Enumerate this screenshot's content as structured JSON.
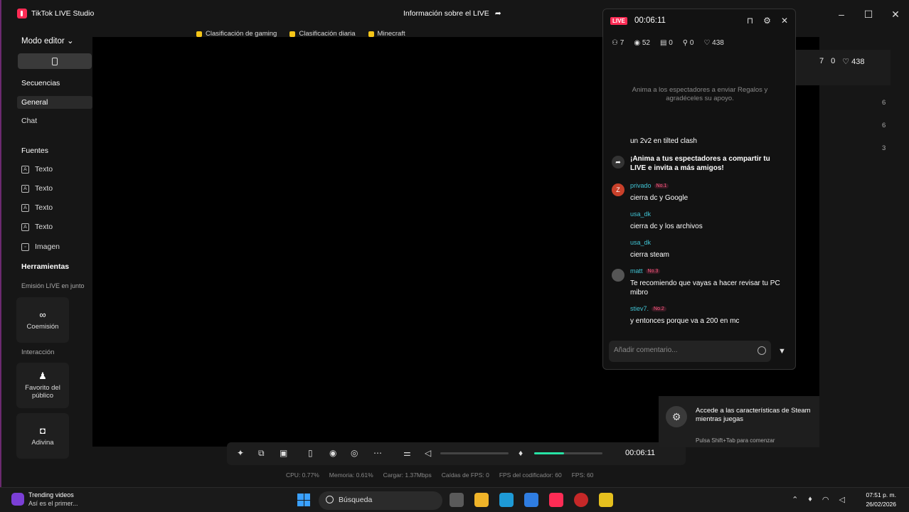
{
  "titlebar": {
    "app_name": "TikTok LIVE Studio",
    "live_info": "Información sobre el LIVE"
  },
  "sidebar": {
    "mode": "Modo editor",
    "scenes_title": "Secuencias",
    "scenes": [
      "General",
      "Chat"
    ],
    "sources_title": "Fuentes",
    "sources": [
      "Texto",
      "Texto",
      "Texto",
      "Texto",
      "Imagen"
    ],
    "tools_title": "Herramientas",
    "tools_sub": "Emisión LIVE en junto",
    "tools": {
      "coemision": "Coemisión",
      "interaccion_title": "Interacción",
      "favorito": "Favorito del público",
      "adivina": "Adivina"
    }
  },
  "tags": [
    "Clasificación de gaming",
    "Clasificación diaria",
    "Minecraft"
  ],
  "controls": {
    "timer": "00:06:11",
    "mic_level": 0.44
  },
  "stats_bar": [
    "CPU: 0.77%",
    "Memoria: 0.61%",
    "Cargar: 1.37Mbps",
    "Caídas de FPS: 0",
    "FPS del codificador: 60",
    "FPS: 60"
  ],
  "right_peek": {
    "users": "7",
    "gifts": "0",
    "likes": "438",
    "nums": [
      "6",
      "6",
      "3"
    ]
  },
  "chat": {
    "live_badge": "LIVE",
    "time": "00:06:11",
    "metrics": {
      "viewers": "7",
      "views": "52",
      "gifts": "0",
      "followers": "0",
      "likes": "438"
    },
    "promo": "Anima a los espectadores a enviar Regalos y agradéceles su apoyo.",
    "messages": [
      {
        "text": "un 2v2 en tilted clash"
      },
      {
        "text": "¡Anima a tus espectadores a compartir tu LIVE e invita a más amigos!"
      },
      {
        "user": "privado",
        "badge": "No.1",
        "avatar": "Z",
        "text": "cierra dc y Google"
      },
      {
        "user": "usa_dk",
        "text": "cierra dc y los archivos"
      },
      {
        "user": "usa_dk",
        "text": "cierra steam"
      },
      {
        "user": "matt",
        "badge": "No.3",
        "text": "Te recomiendo que vayas a hacer revisar tu PC mibro"
      },
      {
        "user": "stiev7.",
        "badge": "No.2",
        "text": "y entonces porque va a 200 en mc"
      }
    ],
    "input_placeholder": "Añadir comentario..."
  },
  "steam": {
    "message": "Accede a las características de Steam mientras juegas",
    "hint": "Pulsa Shift+Tab para comenzar"
  },
  "taskbar": {
    "trend_title": "Trending videos",
    "trend_sub": "Así es el primer...",
    "search": "Búsqueda",
    "time": "07:51 p. m.",
    "date": "26/02/2026"
  }
}
